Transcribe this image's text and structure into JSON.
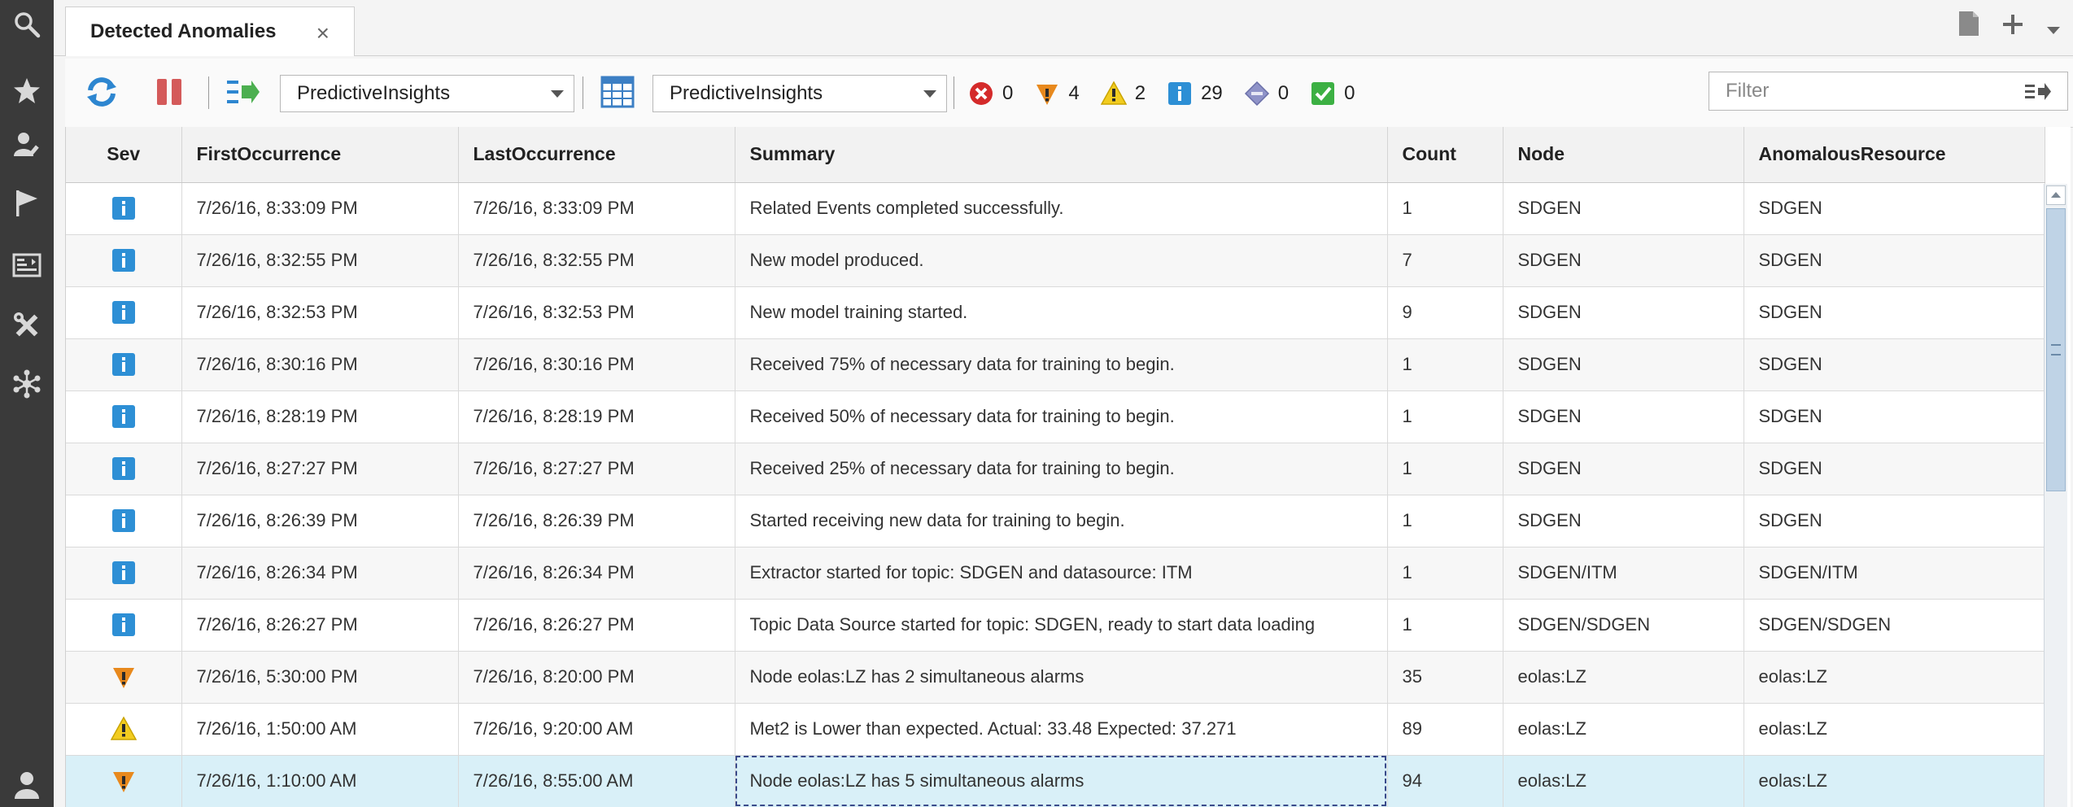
{
  "tab": {
    "title": "Detected Anomalies",
    "close": "×"
  },
  "toolbar": {
    "filter_select_value": "PredictiveInsights",
    "view_select_value": "PredictiveInsights",
    "filter_placeholder": "Filter"
  },
  "severity_counts": [
    {
      "icon": "critical-icon",
      "count": "0"
    },
    {
      "icon": "major-icon",
      "count": "4"
    },
    {
      "icon": "minor-icon",
      "count": "2"
    },
    {
      "icon": "info-icon",
      "count": "29"
    },
    {
      "icon": "indeterminate-icon",
      "count": "0"
    },
    {
      "icon": "clear-icon",
      "count": "0"
    }
  ],
  "table": {
    "columns": [
      "Sev",
      "FirstOccurrence",
      "LastOccurrence",
      "Summary",
      "Count",
      "Node",
      "AnomalousResource"
    ],
    "rows": [
      {
        "sev": "info",
        "first": "7/26/16, 8:33:09 PM",
        "last": "7/26/16, 8:33:09 PM",
        "summary": "Related Events completed successfully.",
        "count": "1",
        "node": "SDGEN",
        "resource": "SDGEN"
      },
      {
        "sev": "info",
        "first": "7/26/16, 8:32:55 PM",
        "last": "7/26/16, 8:32:55 PM",
        "summary": "New model produced.",
        "count": "7",
        "node": "SDGEN",
        "resource": "SDGEN"
      },
      {
        "sev": "info",
        "first": "7/26/16, 8:32:53 PM",
        "last": "7/26/16, 8:32:53 PM",
        "summary": "New model training started.",
        "count": "9",
        "node": "SDGEN",
        "resource": "SDGEN"
      },
      {
        "sev": "info",
        "first": "7/26/16, 8:30:16 PM",
        "last": "7/26/16, 8:30:16 PM",
        "summary": "Received 75% of necessary data for training to begin.",
        "count": "1",
        "node": "SDGEN",
        "resource": "SDGEN"
      },
      {
        "sev": "info",
        "first": "7/26/16, 8:28:19 PM",
        "last": "7/26/16, 8:28:19 PM",
        "summary": "Received 50% of necessary data for training to begin.",
        "count": "1",
        "node": "SDGEN",
        "resource": "SDGEN"
      },
      {
        "sev": "info",
        "first": "7/26/16, 8:27:27 PM",
        "last": "7/26/16, 8:27:27 PM",
        "summary": "Received 25% of necessary data for training to begin.",
        "count": "1",
        "node": "SDGEN",
        "resource": "SDGEN"
      },
      {
        "sev": "info",
        "first": "7/26/16, 8:26:39 PM",
        "last": "7/26/16, 8:26:39 PM",
        "summary": "Started receiving new data for training to begin.",
        "count": "1",
        "node": "SDGEN",
        "resource": "SDGEN"
      },
      {
        "sev": "info",
        "first": "7/26/16, 8:26:34 PM",
        "last": "7/26/16, 8:26:34 PM",
        "summary": "Extractor started for topic: SDGEN and datasource: ITM",
        "count": "1",
        "node": "SDGEN/ITM",
        "resource": "SDGEN/ITM"
      },
      {
        "sev": "info",
        "first": "7/26/16, 8:26:27 PM",
        "last": "7/26/16, 8:26:27 PM",
        "summary": "Topic Data Source started for topic: SDGEN, ready to start data loading",
        "count": "1",
        "node": "SDGEN/SDGEN",
        "resource": "SDGEN/SDGEN"
      },
      {
        "sev": "major",
        "first": "7/26/16, 5:30:00 PM",
        "last": "7/26/16, 8:20:00 PM",
        "summary": "Node eolas:LZ has 2 simultaneous alarms",
        "count": "35",
        "node": "eolas:LZ",
        "resource": "eolas:LZ"
      },
      {
        "sev": "minor",
        "first": "7/26/16, 1:50:00 AM",
        "last": "7/26/16, 9:20:00 AM",
        "summary": "Met2 is Lower than expected. Actual: 33.48 Expected: 37.271",
        "count": "89",
        "node": "eolas:LZ",
        "resource": "eolas:LZ"
      },
      {
        "sev": "major",
        "first": "7/26/16, 1:10:00 AM",
        "last": "7/26/16, 8:55:00 AM",
        "summary": "Node eolas:LZ has 5 simultaneous alarms",
        "count": "94",
        "node": "eolas:LZ",
        "resource": "eolas:LZ"
      }
    ]
  },
  "colors": {
    "sidebar": "#3a3a3a",
    "info": "#2d8fd5",
    "major": "#e8891d",
    "minor": "#f2cc1f",
    "critical": "#d42a2a",
    "clear": "#3cb043",
    "indeterminate": "#8f93c8",
    "selected_row": "#d9f0f8"
  }
}
